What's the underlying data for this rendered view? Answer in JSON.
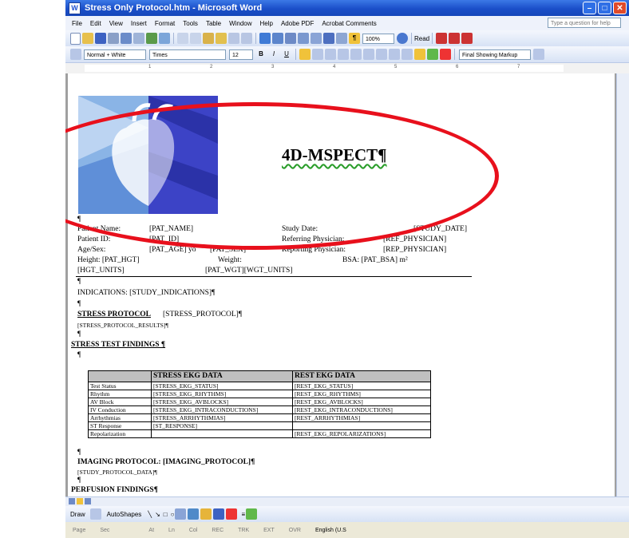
{
  "window": {
    "title": "Stress Only Protocol.htm - Microsoft Word"
  },
  "menu": [
    "File",
    "Edit",
    "View",
    "Insert",
    "Format",
    "Tools",
    "Table",
    "Window",
    "Help",
    "Adobe PDF",
    "Acrobat Comments"
  ],
  "help_placeholder": "Type a question for help",
  "toolbar": {
    "zoom": "100%",
    "read_label": "Read",
    "style": "Normal + White",
    "font": "Times",
    "size": "12",
    "markup": "Final Showing Markup"
  },
  "ruler_marks": [
    "1",
    "2",
    "3",
    "4",
    "5",
    "6",
    "7"
  ],
  "document": {
    "logo_title": "4D-MSPECT¶",
    "pilcrow": "¶",
    "patient": {
      "name_label": "Patient Name:",
      "name_value": "[PAT_NAME]",
      "id_label": "Patient ID:",
      "id_value": "[PAT_ID]",
      "agesex_label": "Age/Sex:",
      "age_value": "[PAT_AGE] yo",
      "sex_value": "[PAT_SEX]",
      "height_label": "Height: [PAT_HGT]",
      "hgt_units": "[HGT_UNITS]",
      "weight_label": "Weight:",
      "weight_value": "[PAT_WGT][WGT_UNITS]",
      "study_date_label": "Study Date:",
      "study_date_value": "[STUDY_DATE]",
      "ref_label": "Referring Physician:",
      "ref_value": "[REF_PHYSICIAN]",
      "rep_label": "Reporting Physician:",
      "rep_value": "[REP_PHYSICIAN]",
      "bsa_label": "BSA: [PAT_BSA] m²"
    },
    "indications": "INDICATIONS: [STUDY_INDICATIONS]¶",
    "stress_protocol_head": "STRESS PROTOCOL",
    "stress_protocol_value": " [STRESS_PROTOCOL]¶",
    "stress_protocol_results": "[STRESS_PROTOCOL_RESULTS]¶",
    "stress_test_findings": "STRESS TEST FINDINGS ¶",
    "ekg_table": {
      "headers": [
        "",
        "STRESS EKG DATA",
        "REST EKG DATA"
      ],
      "rows": [
        [
          "Test Status",
          "[STRESS_EKG_STATUS]",
          "[REST_EKG_STATUS]"
        ],
        [
          "Rhythm",
          "[STRESS_EKG_RHYTHMS]",
          "[REST_EKG_RHYTHMS]"
        ],
        [
          "AV Block",
          "[STRESS_EKG_AVBLOCKS]",
          "[REST_EKG_AVBLOCKS]"
        ],
        [
          "IV Conduction",
          "[STRESS_EKG_INTRACONDUCTIONS]",
          "[REST_EKG_INTRACONDUCTIONS]"
        ],
        [
          "Arrhythmias",
          "[STRESS_ARRHYTHMIAS]",
          "[REST_ARRHYTHMIAS]"
        ],
        [
          "ST Response",
          "[ST_RESPONSE]",
          ""
        ],
        [
          "Repolarization",
          "",
          "[REST_EKG_REPOLARIZATIONS]"
        ]
      ]
    },
    "imaging_protocol": "IMAGING PROTOCOL: [IMAGING_PROTOCOL]¶",
    "study_protocol_data": "[STUDY_PROTOCOL_DATA]¶",
    "perfusion_findings": "PERFUSION FINDINGS¶"
  },
  "drawbar": {
    "draw_label": "Draw",
    "autoshapes_label": "AutoShapes"
  },
  "status": {
    "page": "Page",
    "sec": "Sec",
    "at": "At",
    "ln": "Ln",
    "col": "Col",
    "rec": "REC",
    "trk": "TRK",
    "ext": "EXT",
    "ovr": "OVR",
    "lang": "English (U.S"
  },
  "annotation": {
    "ellipse_color": "#e8101c"
  }
}
